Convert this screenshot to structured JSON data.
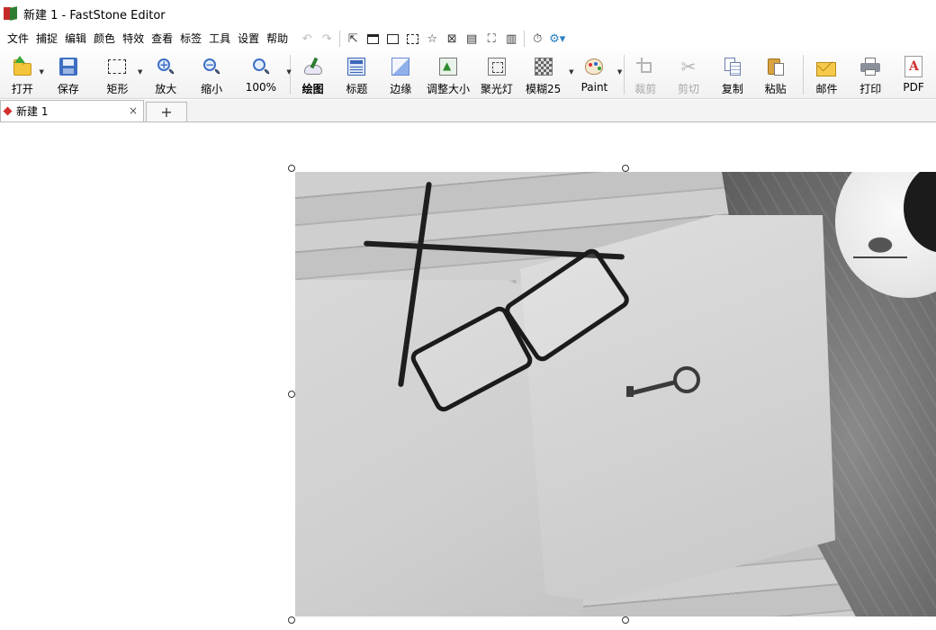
{
  "window": {
    "title": "新建 1 - FastStone Editor"
  },
  "menu": {
    "items": [
      "文件",
      "捕捉",
      "编辑",
      "颜色",
      "特效",
      "查看",
      "标签",
      "工具",
      "设置",
      "帮助"
    ]
  },
  "toolbar": {
    "open": "打开",
    "save": "保存",
    "rect": "矩形",
    "zoom_in": "放大",
    "zoom_out": "缩小",
    "zoom_level": "100%",
    "draw": "绘图",
    "caption": "标题",
    "edge": "边缘",
    "resize": "调整大小",
    "spotlight": "聚光灯",
    "blur": "模糊25",
    "paint": "Paint",
    "crop": "裁剪",
    "cut": "剪切",
    "copy": "复制",
    "paste": "粘贴",
    "email": "邮件",
    "print": "打印",
    "pdf": "PDF"
  },
  "tabs": {
    "active_label": "新建 1",
    "close_glyph": "×",
    "add_glyph": "+"
  },
  "colors": {
    "tab_marker": "#d32f2f",
    "toolbar_blue": "#3c6fc4",
    "disabled_text": "#a8a8a8"
  }
}
